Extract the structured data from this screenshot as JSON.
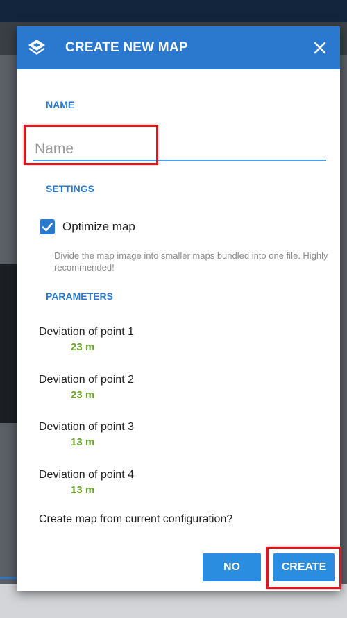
{
  "dialog": {
    "title": "CREATE NEW MAP",
    "header_icon": "layers-icon",
    "close_icon": "close-icon"
  },
  "name_section": {
    "label": "NAME",
    "input_value": "",
    "input_placeholder": "Name"
  },
  "settings_section": {
    "label": "SETTINGS",
    "optimize_checked": true,
    "optimize_label": "Optimize map",
    "optimize_help": "Divide the map image into smaller maps bundled into one file. Highly recommended!"
  },
  "parameters_section": {
    "label": "PARAMETERS",
    "deviations": [
      {
        "label": "Deviation of point 1",
        "value": "23 m"
      },
      {
        "label": "Deviation of point 2",
        "value": "23 m"
      },
      {
        "label": "Deviation of point 3",
        "value": "13 m"
      },
      {
        "label": "Deviation of point 4",
        "value": "13 m"
      }
    ]
  },
  "question": "Create map from current configuration?",
  "buttons": {
    "no_label": "NO",
    "create_label": "CREATE"
  },
  "colors": {
    "header": "#2b79cf",
    "accent": "#2b79cf",
    "value_green": "#6aa52a",
    "highlight_red": "#e0161b",
    "button": "#2b8de0"
  }
}
